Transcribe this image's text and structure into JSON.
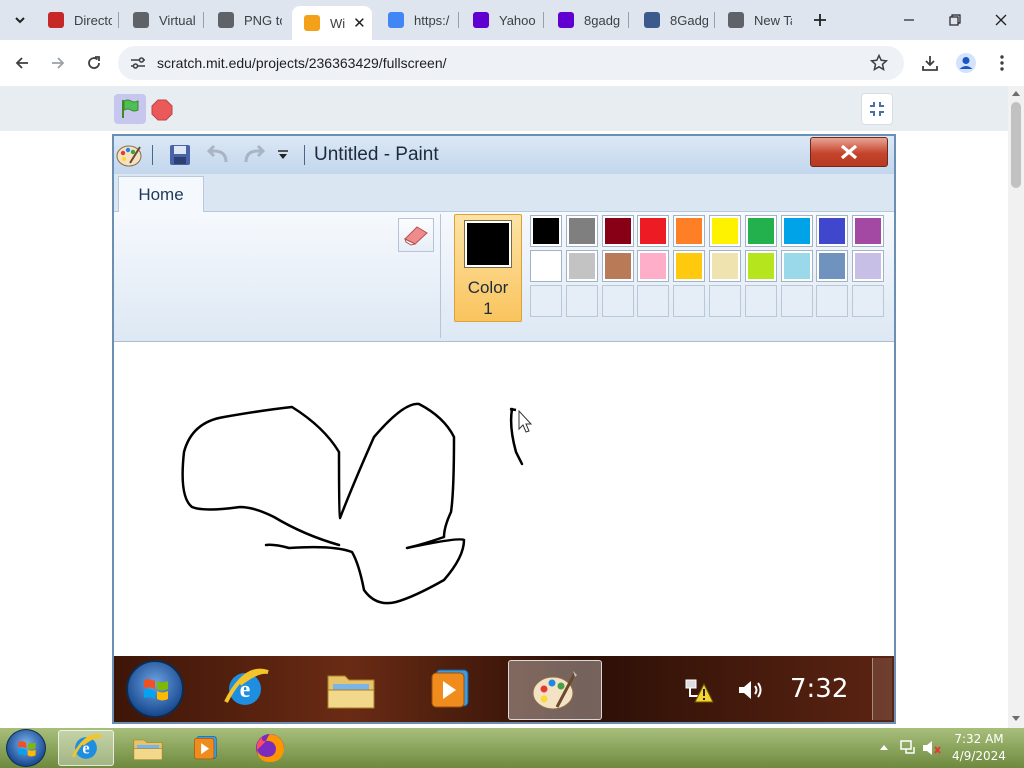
{
  "browser": {
    "tabs": [
      {
        "label": "Directo",
        "icon": "red-bird-icon",
        "color": "#c62828"
      },
      {
        "label": "Virtual",
        "icon": "wikipedia-icon",
        "color": "#5f6368"
      },
      {
        "label": "PNG to",
        "icon": "cloud-icon",
        "color": "#5f6368"
      },
      {
        "label": "Wi",
        "icon": "scratch-icon",
        "color": "#f4a11a",
        "active": true
      },
      {
        "label": "https:/",
        "icon": "google-icon",
        "color": "#4285f4"
      },
      {
        "label": "Yahoo",
        "icon": "yahoo-icon",
        "color": "#6001d2"
      },
      {
        "label": "8gadg",
        "icon": "yahoo-icon",
        "color": "#6001d2"
      },
      {
        "label": "8Gadg",
        "icon": "computer-icon",
        "color": "#3b5b8c"
      },
      {
        "label": "New Ta",
        "icon": "chrome-icon",
        "color": "#5f6368"
      }
    ],
    "url": "scratch.mit.edu/projects/236363429/fullscreen/"
  },
  "paint": {
    "title": "Untitled - Paint",
    "home_tab": "Home",
    "color1_label": "Color",
    "color1_number": "1",
    "color1_value": "#000000",
    "palette_row1": [
      "#000000",
      "#7f7f7f",
      "#880015",
      "#ed1c24",
      "#ff7f27",
      "#fff200",
      "#22b14c",
      "#00a2e8",
      "#3f48cc",
      "#a349a4"
    ],
    "palette_row2": [
      "#ffffff",
      "#c3c3c3",
      "#b97a57",
      "#ffaec9",
      "#ffc90e",
      "#efe4b0",
      "#b5e61d",
      "#99d9ea",
      "#7092be",
      "#c8bfe7"
    ]
  },
  "vm_taskbar": {
    "clock": "7:32"
  },
  "windows_taskbar": {
    "time": "7:32 AM",
    "date": "4/9/2024"
  }
}
